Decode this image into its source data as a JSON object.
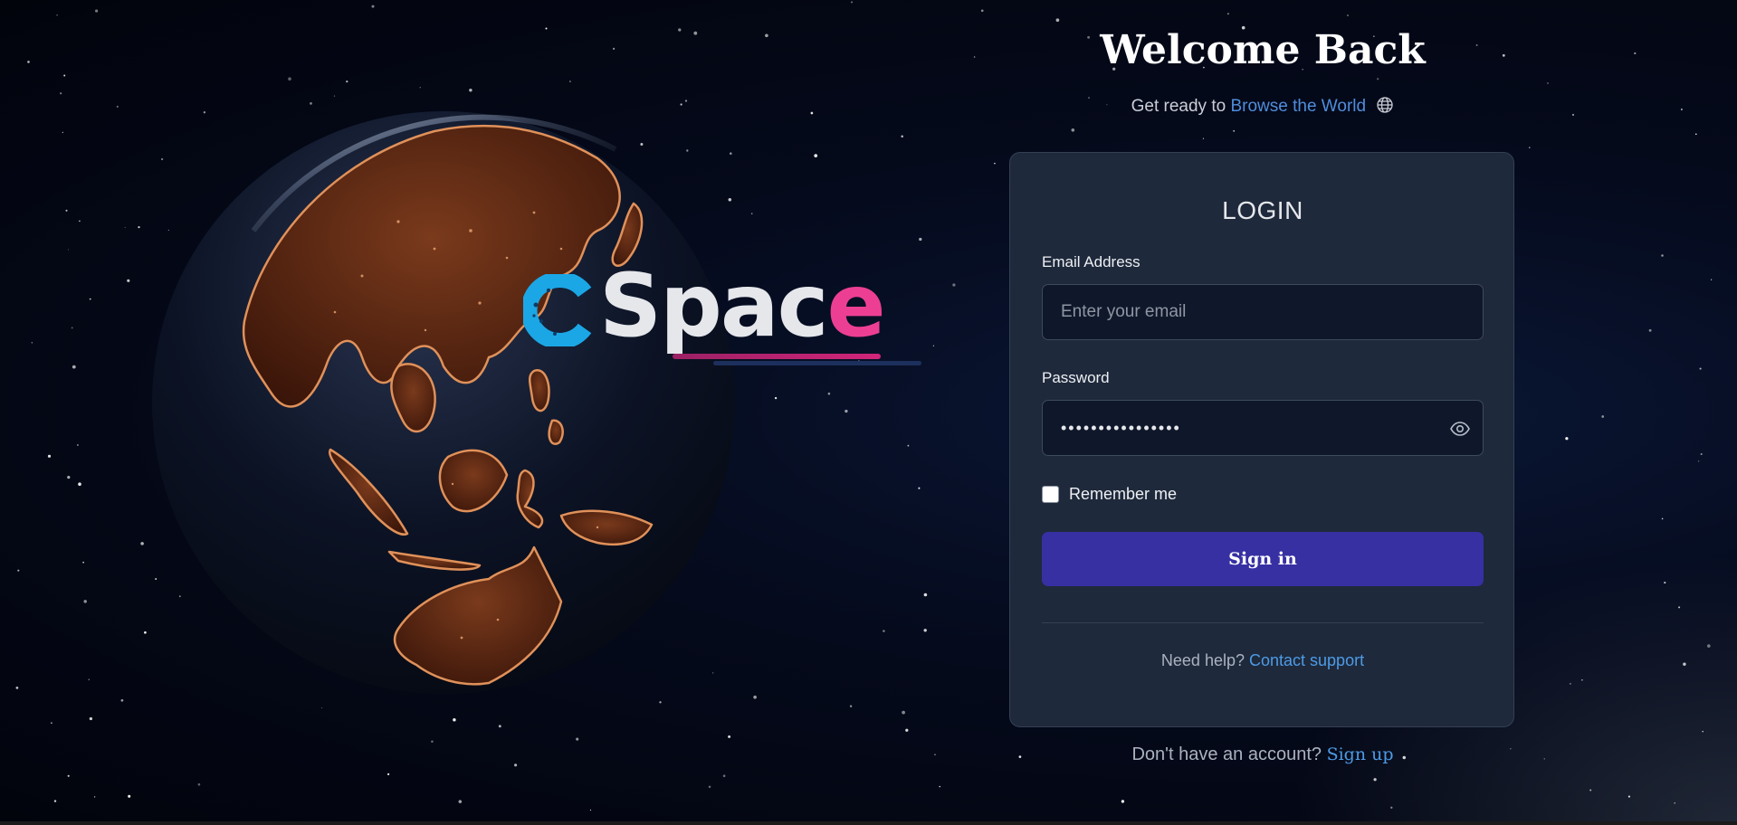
{
  "brand": {
    "name_main": "Spac",
    "name_accent": "e",
    "colors": {
      "c_mark": "#1ba7e6",
      "text": "#e5e7eb",
      "accent": "#ec3f93"
    },
    "icon": "cspace-c-logo"
  },
  "header": {
    "title": "Welcome Back",
    "subtitle_prefix": "Get ready to",
    "subtitle_link": "Browse the World",
    "subtitle_icon": "globe-icon"
  },
  "login_card": {
    "title": "LOGIN",
    "email": {
      "label": "Email Address",
      "placeholder": "Enter your email",
      "value": ""
    },
    "password": {
      "label": "Password",
      "value": "••••••••••••••••",
      "toggle_icon": "eye-icon"
    },
    "remember_me": {
      "label": "Remember me",
      "checked": false
    },
    "submit_label": "Sign in",
    "help_prefix": "Need help?",
    "help_link": "Contact support"
  },
  "footer": {
    "signup_prefix": "Don't have an account?",
    "signup_link": "Sign up"
  },
  "colors": {
    "primary_button": "#3730a3",
    "link": "#4d9be6",
    "card_bg": "#1e293b",
    "input_bg": "#0f172a",
    "page_bg": "#050a1c"
  }
}
